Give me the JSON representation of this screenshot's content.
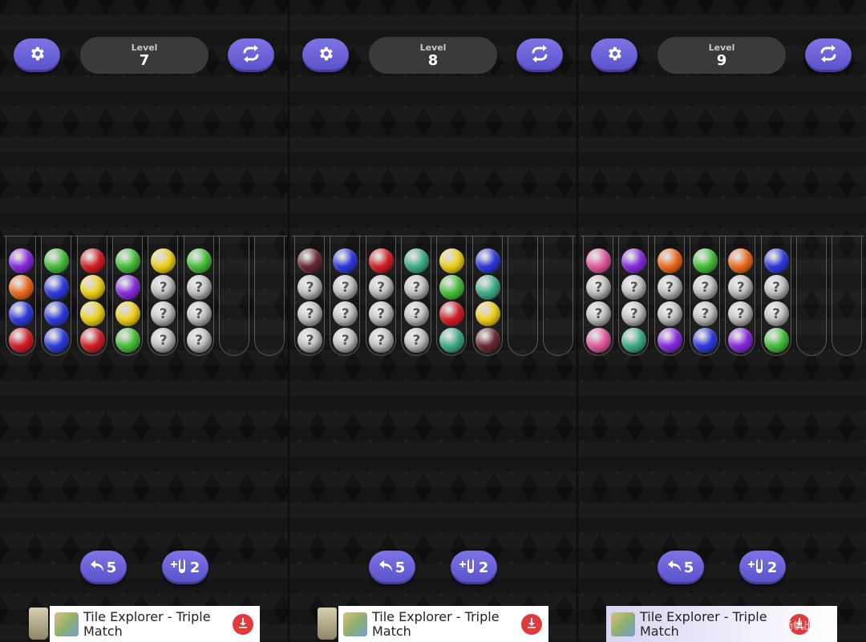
{
  "panels": [
    {
      "level_label": "Level",
      "level": "7",
      "tubes": [
        [
          "purple",
          "orange",
          "blue",
          "red"
        ],
        [
          "green",
          "blue",
          "blue",
          "blue"
        ],
        [
          "red",
          "yellow",
          "yellow",
          "red"
        ],
        [
          "green",
          "purple",
          "yellow",
          "green"
        ],
        [
          "yellow",
          "unknown",
          "unknown",
          "unknown"
        ],
        [
          "green",
          "unknown",
          "unknown",
          "unknown"
        ],
        [],
        []
      ],
      "undo_count": "5",
      "tube_add_count": "2"
    },
    {
      "level_label": "Level",
      "level": "8",
      "tubes": [
        [
          "maroon",
          "unknown",
          "unknown",
          "unknown"
        ],
        [
          "blue",
          "unknown",
          "unknown",
          "unknown"
        ],
        [
          "red",
          "unknown",
          "unknown",
          "unknown"
        ],
        [
          "teal",
          "unknown",
          "unknown",
          "unknown"
        ],
        [
          "yellow",
          "green",
          "red",
          "teal"
        ],
        [
          "blue",
          "teal",
          "yellow",
          "maroon"
        ],
        [],
        []
      ],
      "undo_count": "5",
      "tube_add_count": "2"
    },
    {
      "level_label": "Level",
      "level": "9",
      "tubes": [
        [
          "pink",
          "unknown",
          "unknown",
          "pink"
        ],
        [
          "purple",
          "unknown",
          "unknown",
          "teal"
        ],
        [
          "orange",
          "unknown",
          "unknown",
          "purple"
        ],
        [
          "green",
          "unknown",
          "unknown",
          "blue"
        ],
        [
          "orange",
          "unknown",
          "unknown",
          "purple"
        ],
        [
          "blue",
          "unknown",
          "unknown",
          "green"
        ],
        [],
        []
      ],
      "undo_count": "5",
      "tube_add_count": "2"
    }
  ],
  "ad": {
    "title": "Tile Explorer - Triple Match"
  },
  "colors": {
    "purple": "#8a2be2",
    "orange": "#f26b1d",
    "blue": "#2f3be0",
    "red": "#d61f26",
    "green": "#46c23b",
    "yellow": "#f2d21a",
    "teal": "#3fae8c",
    "maroon": "#6b2a33",
    "pink": "#e55aa0",
    "accent": "#6c63dd",
    "ad_download": "#e03a3a"
  },
  "icons": {
    "settings": "gear-icon",
    "restart": "refresh-icon",
    "undo": "undo-arrow-icon",
    "add_tube": "add-tube-icon",
    "download": "download-icon"
  },
  "watermark": "扬帆出海"
}
